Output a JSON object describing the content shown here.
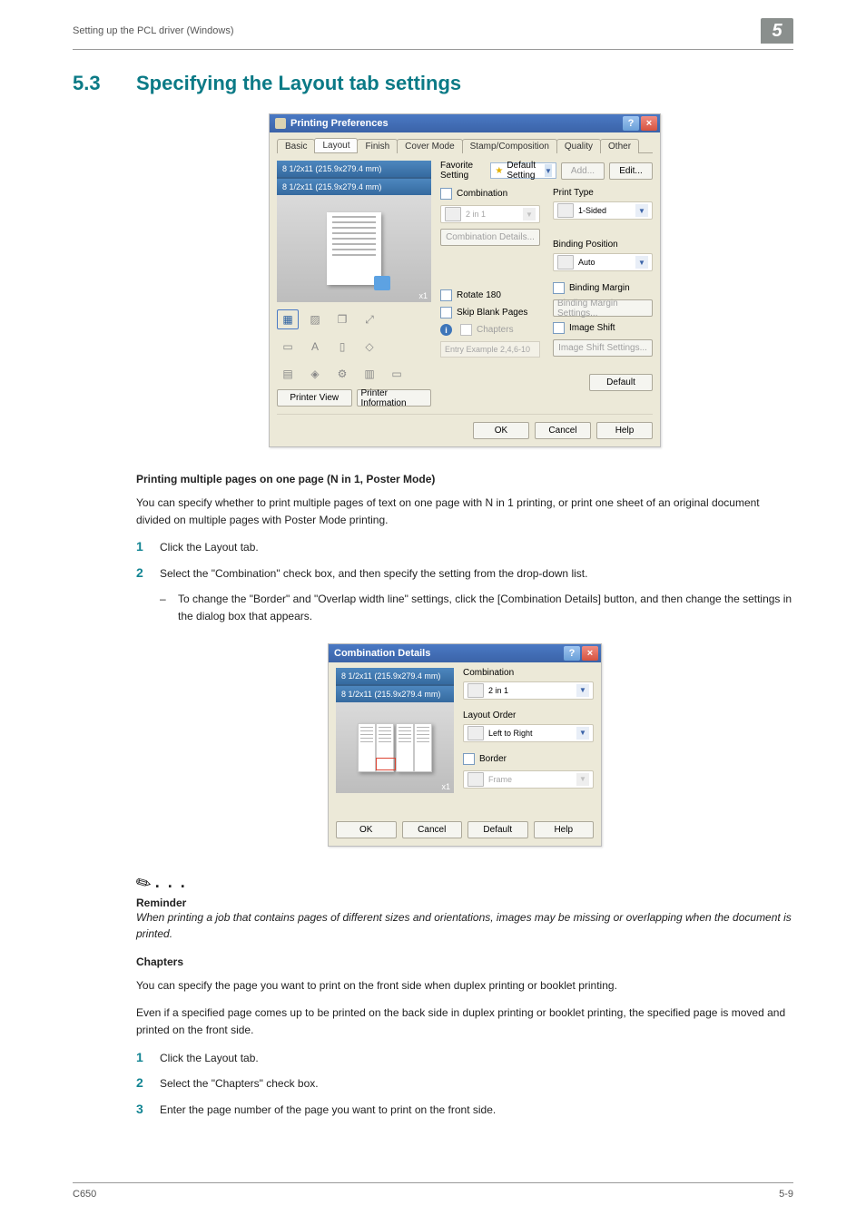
{
  "running_head": "Setting up the PCL driver (Windows)",
  "chapter_num": "5",
  "h1_num": "5.3",
  "h1_text": "Specifying the Layout tab settings",
  "dlg1": {
    "title": "Printing Preferences",
    "help": "?",
    "close": "×",
    "tabs": [
      "Basic",
      "Layout",
      "Finish",
      "Cover Mode",
      "Stamp/Composition",
      "Quality",
      "Other"
    ],
    "paper1": "8 1/2x11 (215.9x279.4 mm)",
    "paper2": "8 1/2x11 (215.9x279.4 mm)",
    "x1": "x1",
    "printer_view": "Printer View",
    "printer_info": "Printer Information",
    "fav_label": "Favorite Setting",
    "fav_value": "Default Setting",
    "add_btn": "Add...",
    "edit_btn": "Edit...",
    "combination_chk": "Combination",
    "combination_value": "2 in 1",
    "comb_details_btn": "Combination Details...",
    "rotate_chk": "Rotate 180",
    "skip_chk": "Skip Blank Pages",
    "chapters_chk": "Chapters",
    "chapters_hint": "Entry Example 2,4,6-10",
    "print_type_label": "Print Type",
    "print_type_value": "1-Sided",
    "binding_pos_label": "Binding Position",
    "binding_pos_value": "Auto",
    "binding_margin_chk": "Binding Margin",
    "binding_margin_btn": "Binding Margin Settings...",
    "image_shift_chk": "Image Shift",
    "image_shift_btn": "Image Shift Settings...",
    "default_btn": "Default",
    "ok_btn": "OK",
    "cancel_btn": "Cancel",
    "help_btn2": "Help"
  },
  "sub1_head": "Printing multiple pages on one page (N in 1, Poster Mode)",
  "sub1_para": "You can specify whether to print multiple pages of text on one page with N in 1 printing, or print one sheet of an original document divided on multiple pages with Poster Mode printing.",
  "step1_1": "Click the Layout tab.",
  "step1_2": "Select the \"Combination\" check box, and then specify the setting from the drop-down list.",
  "step1_2_bullet": "To change the \"Border\" and \"Overlap width line\" settings, click the [Combination Details] button, and then change the settings in the dialog box that appears.",
  "dlg2": {
    "title": "Combination Details",
    "help": "?",
    "close": "×",
    "paper1": "8 1/2x11 (215.9x279.4 mm)",
    "paper2": "8 1/2x11 (215.9x279.4 mm)",
    "x1": "x1",
    "comb_label": "Combination",
    "comb_value": "2 in 1",
    "order_label": "Layout Order",
    "order_value": "Left to Right",
    "border_chk": "Border",
    "frame_value": "Frame",
    "ok_btn": "OK",
    "cancel_btn": "Cancel",
    "default_btn": "Default",
    "help_btn": "Help"
  },
  "reminder_label": "Reminder",
  "reminder_text": "When printing a job that contains pages of different sizes and orientations, images may be missing or overlapping when the document is printed.",
  "sub2_head": "Chapters",
  "sub2_para1": "You can specify the page you want to print on the front side when duplex printing or booklet printing.",
  "sub2_para2": "Even if a specified page comes up to be printed on the back side in duplex printing or booklet printing, the specified page is moved and printed on the front side.",
  "step2_1": "Click the Layout tab.",
  "step2_2": "Select the \"Chapters\" check box.",
  "step2_3": "Enter the page number of the page you want to print on the front side.",
  "footer_left": "C650",
  "footer_right": "5-9"
}
